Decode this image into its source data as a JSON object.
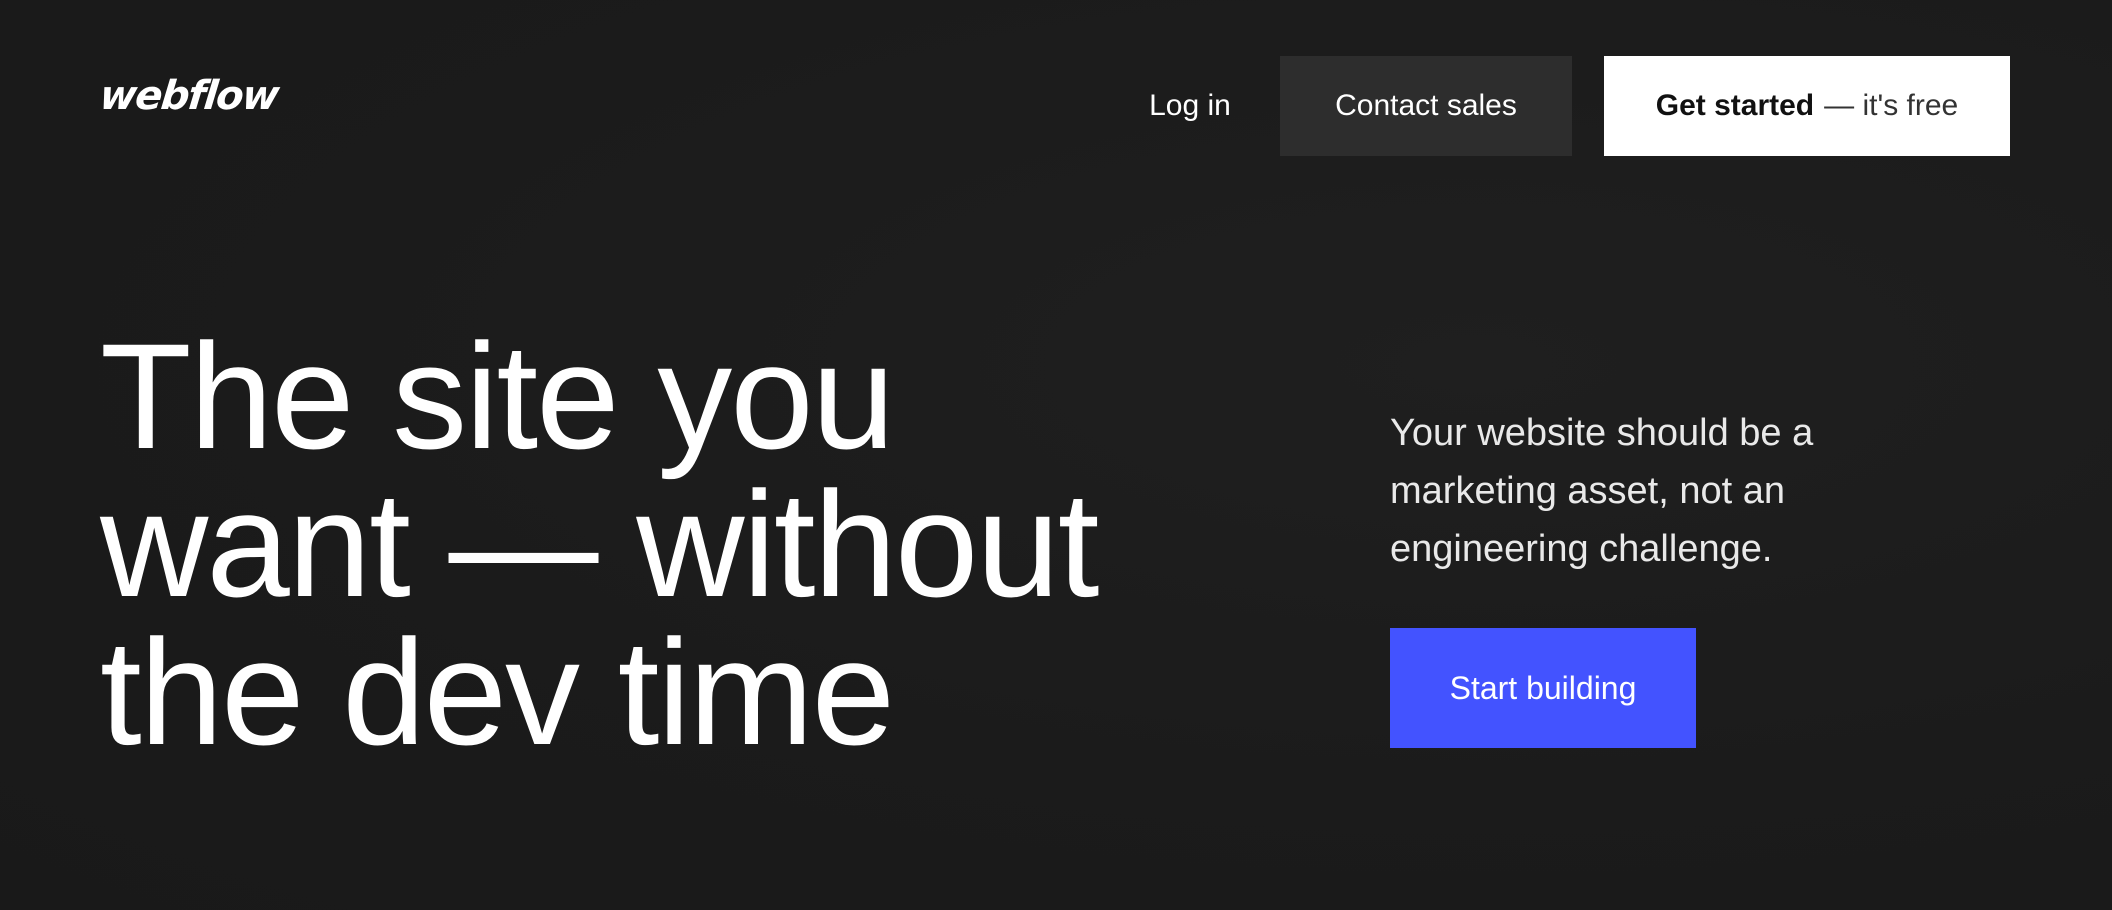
{
  "header": {
    "logo_text": "webflow",
    "nav": {
      "login_label": "Log in",
      "contact_label": "Contact sales",
      "get_started_strong": "Get started",
      "get_started_light": "— it's free"
    }
  },
  "hero": {
    "title_lines": [
      "The site you",
      "want — without",
      "the dev time"
    ],
    "subtitle_lines": [
      "Your website should be a",
      "marketing asset, not an",
      "engineering challenge."
    ],
    "cta_label": "Start building"
  },
  "colors": {
    "background": "#1b1b1b",
    "secondary_button": "#2d2d2d",
    "primary_button": "#ffffff",
    "accent": "#4353ff",
    "text": "#ffffff"
  }
}
